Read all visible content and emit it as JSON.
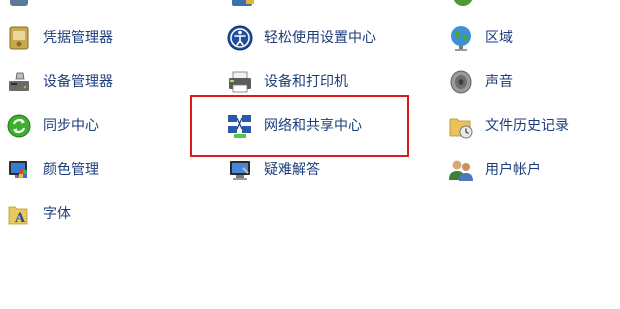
{
  "items": [
    {
      "id": "credential-manager",
      "label": "凭据管理器",
      "icon": "credential-manager-icon"
    },
    {
      "id": "ease-of-access",
      "label": "轻松使用设置中心",
      "icon": "ease-of-access-icon"
    },
    {
      "id": "region",
      "label": "区域",
      "icon": "region-globe-icon"
    },
    {
      "id": "device-manager",
      "label": "设备管理器",
      "icon": "device-manager-icon"
    },
    {
      "id": "devices-printers",
      "label": "设备和打印机",
      "icon": "printer-icon"
    },
    {
      "id": "sound",
      "label": "声音",
      "icon": "speaker-icon"
    },
    {
      "id": "sync-center",
      "label": "同步中心",
      "icon": "sync-icon"
    },
    {
      "id": "network-sharing",
      "label": "网络和共享中心",
      "icon": "network-icon"
    },
    {
      "id": "file-history",
      "label": "文件历史记录",
      "icon": "file-history-icon"
    },
    {
      "id": "color-management",
      "label": "颜色管理",
      "icon": "color-management-icon"
    },
    {
      "id": "troubleshooting",
      "label": "疑难解答",
      "icon": "troubleshooting-icon"
    },
    {
      "id": "user-accounts",
      "label": "用户帐户",
      "icon": "user-accounts-icon"
    },
    {
      "id": "fonts",
      "label": "字体",
      "icon": "font-folder-icon"
    }
  ],
  "colors": {
    "link_text": "#1c3d7a",
    "highlight_border": "#d81c1c",
    "background": "#ffffff"
  }
}
